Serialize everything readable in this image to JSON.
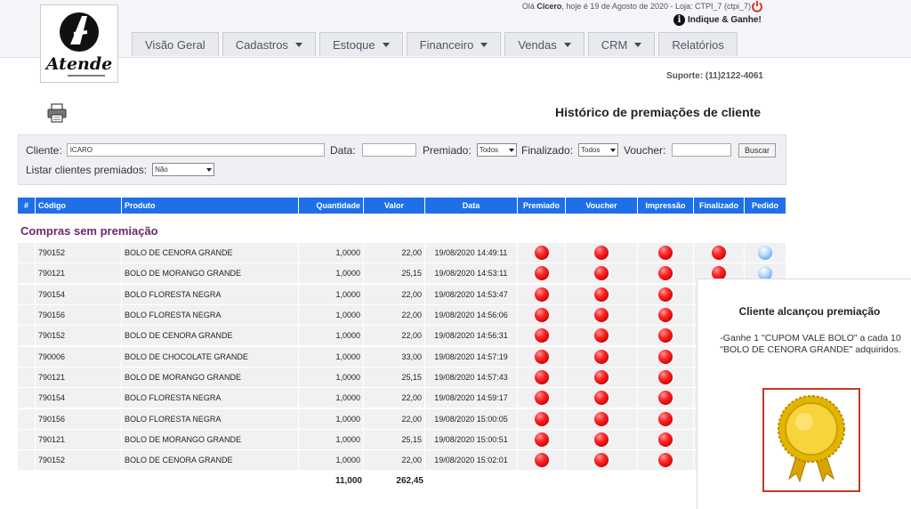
{
  "header": {
    "greeting_prefix": "Olá ",
    "user": "Cicero",
    "greeting_suffix": ", hoje é 19 de Agosto de 2020 - Loja: CTPI_7 (ctpi_7)",
    "indique": "Indique & Ganhe!",
    "logo_text": "Atende",
    "tabs": [
      {
        "label": "Visão Geral",
        "caret": false
      },
      {
        "label": "Cadastros",
        "caret": true
      },
      {
        "label": "Estoque",
        "caret": true
      },
      {
        "label": "Financeiro",
        "caret": true
      },
      {
        "label": "Vendas",
        "caret": true
      },
      {
        "label": "CRM",
        "caret": true
      },
      {
        "label": "Relatórios",
        "caret": false
      }
    ]
  },
  "support": "Suporte: (11)2122-4061",
  "page_title": "Histórico de premiações de cliente",
  "filters": {
    "cliente_label": "Cliente:",
    "cliente_value": "ICARO",
    "data_label": "Data:",
    "data_value": "",
    "premiado_label": "Premiado:",
    "premiado_value": "Todos",
    "finalizado_label": "Finalizado:",
    "finalizado_value": "Todos",
    "voucher_label": "Voucher:",
    "voucher_value": "",
    "buscar": "Buscar",
    "listar_label": "Listar clientes premiados:",
    "listar_value": "Não"
  },
  "columns": [
    "#",
    "Código",
    "Produto",
    "Quantidade",
    "Valor",
    "Data",
    "Premiado",
    "Voucher",
    "Impressão",
    "Finalizado",
    "Pedido"
  ],
  "section_title": "Compras sem premiação",
  "rows": [
    {
      "codigo": "790152",
      "produto": "BOLO DE CENORA GRANDE",
      "quantidade": "1,0000",
      "valor": "22,00",
      "data": "19/08/2020 14:49:11"
    },
    {
      "codigo": "790121",
      "produto": "BOLO DE MORANGO GRANDE",
      "quantidade": "1,0000",
      "valor": "25,15",
      "data": "19/08/2020 14:53:11"
    },
    {
      "codigo": "790154",
      "produto": "BOLO FLORESTA NEGRA",
      "quantidade": "1,0000",
      "valor": "22,00",
      "data": "19/08/2020 14:53:47"
    },
    {
      "codigo": "790156",
      "produto": "BOLO FLORESTA NEGRA",
      "quantidade": "1,0000",
      "valor": "22,00",
      "data": "19/08/2020 14:56:06"
    },
    {
      "codigo": "790152",
      "produto": "BOLO DE CENORA GRANDE",
      "quantidade": "1,0000",
      "valor": "22,00",
      "data": "19/08/2020 14:56:31"
    },
    {
      "codigo": "790006",
      "produto": "BOLO DE CHOCOLATE GRANDE",
      "quantidade": "1,0000",
      "valor": "33,00",
      "data": "19/08/2020 14:57:19"
    },
    {
      "codigo": "790121",
      "produto": "BOLO DE MORANGO GRANDE",
      "quantidade": "1,0000",
      "valor": "25,15",
      "data": "19/08/2020 14:57:43"
    },
    {
      "codigo": "790154",
      "produto": "BOLO FLORESTA NEGRA",
      "quantidade": "1,0000",
      "valor": "22,00",
      "data": "19/08/2020 14:59:17"
    },
    {
      "codigo": "790156",
      "produto": "BOLO FLORESTA NEGRA",
      "quantidade": "1,0000",
      "valor": "22,00",
      "data": "19/08/2020 15:00:05"
    },
    {
      "codigo": "790121",
      "produto": "BOLO DE MORANGO GRANDE",
      "quantidade": "1,0000",
      "valor": "25,15",
      "data": "19/08/2020 15:00:51"
    },
    {
      "codigo": "790152",
      "produto": "BOLO DE CENORA GRANDE",
      "quantidade": "1,0000",
      "valor": "22,00",
      "data": "19/08/2020 15:02:01"
    }
  ],
  "totals": {
    "quantidade": "11,000",
    "valor": "262,45"
  },
  "popup": {
    "title": "Cliente alcançou premiação",
    "message": "-Ganhe 1 \"CUPOM VALE BOLO\" a cada 10 \"BOLO DE CENORA GRANDE\" adquiridos."
  },
  "colors": {
    "header_blue": "#1f6fe8",
    "section_purple": "#6a2a6a",
    "status_red": "#e00000",
    "medal_gold": "#d9a400"
  },
  "icons": [
    "printer-icon",
    "power-icon",
    "info-icon",
    "status-dot-icon",
    "order-icon",
    "medal-icon"
  ]
}
